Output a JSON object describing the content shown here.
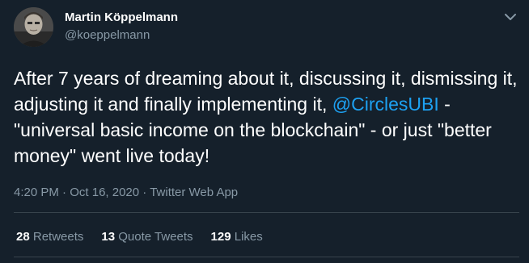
{
  "author": {
    "display_name": "Martin Köppelmann",
    "username": "@koeppelmann",
    "avatar_icon": "profile-photo"
  },
  "menu_icon": "chevron-down-icon",
  "tweet": {
    "text_before": "After 7 years of dreaming about it, discussing it, dismissing it, adjusting it and finally implementing it, ",
    "mention": "@CirclesUBI",
    "text_after": " - \"universal basic income on the blockchain\" - or just \"better money\" went live today!"
  },
  "meta": {
    "time": "4:20 PM",
    "separator": " · ",
    "date": "Oct 16, 2020",
    "source": "Twitter Web App"
  },
  "stats": {
    "retweets_count": "28",
    "retweets_label": "Retweets",
    "quotes_count": "13",
    "quotes_label": "Quote Tweets",
    "likes_count": "129",
    "likes_label": "Likes"
  },
  "colors": {
    "background": "#15202b",
    "secondary_text": "#8899a6",
    "link": "#1da1f2",
    "divider": "#38444d"
  }
}
